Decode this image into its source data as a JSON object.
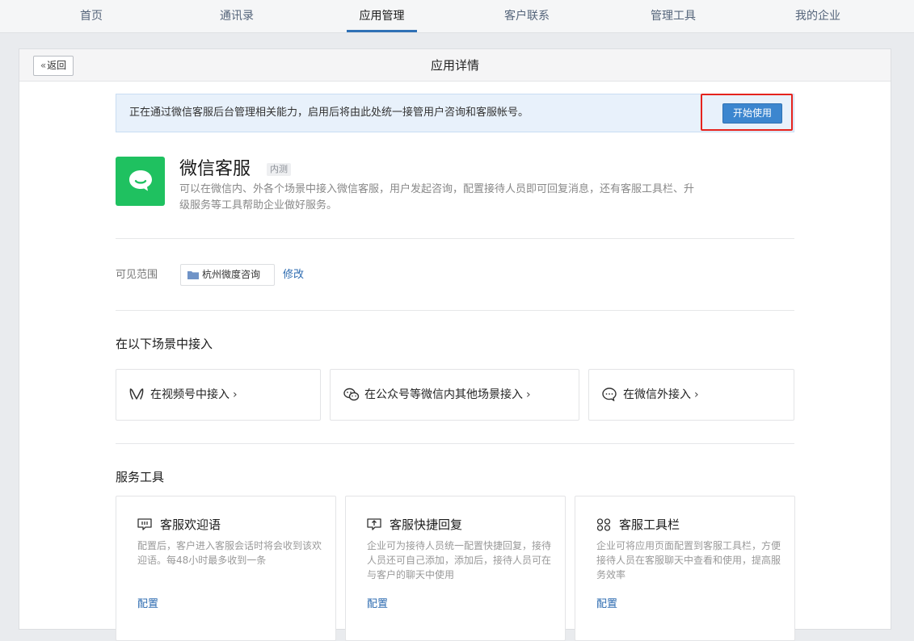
{
  "nav": {
    "tabs": [
      {
        "label": "首页"
      },
      {
        "label": "通讯录"
      },
      {
        "label": "应用管理"
      },
      {
        "label": "客户联系"
      },
      {
        "label": "管理工具"
      },
      {
        "label": "我的企业"
      }
    ],
    "active_tab": "应用管理"
  },
  "header": {
    "back_label": "返回",
    "title": "应用详情"
  },
  "notice": {
    "text": "正在通过微信客服后台管理相关能力，启用后将由此处统一接管用户咨询和客服帐号。",
    "button_label": "开始使用"
  },
  "app": {
    "name": "微信客服",
    "badge": "内测",
    "description": "可以在微信内、外各个场景中接入微信客服，用户发起咨询，配置接待人员即可回复消息，还有客服工具栏、升级服务等工具帮助企业做好服务。"
  },
  "scope": {
    "label": "可见范围",
    "value": "杭州微度咨询",
    "modify_label": "修改"
  },
  "scenes": {
    "title": "在以下场景中接入",
    "items": [
      {
        "label": "在视频号中接入",
        "icon": "channels-icon"
      },
      {
        "label": "在公众号等微信内其他场景接入",
        "icon": "wechat-icon"
      },
      {
        "label": "在微信外接入",
        "icon": "chat-bubble-icon"
      }
    ]
  },
  "tools": {
    "title": "服务工具",
    "items": [
      {
        "name": "客服欢迎语",
        "description": "配置后，客户进入客服会话时将会收到该欢迎语。每48小时最多收到一条",
        "link": "配置",
        "icon": "welcome-message-icon"
      },
      {
        "name": "客服快捷回复",
        "description": "企业可为接待人员统一配置快捷回复，接待人员还可自己添加，添加后，接待人员可在与客户的聊天中使用",
        "link": "配置",
        "icon": "quick-reply-icon"
      },
      {
        "name": "客服工具栏",
        "description": "企业可将应用页面配置到客服工具栏，方便接待人员在客服聊天中查看和使用，提高服务效率",
        "link": "配置",
        "icon": "toolbar-grid-icon"
      }
    ]
  },
  "colors": {
    "accent": "#2f71b5",
    "app_icon": "#1fc160",
    "highlight_frame": "#e5231d"
  }
}
